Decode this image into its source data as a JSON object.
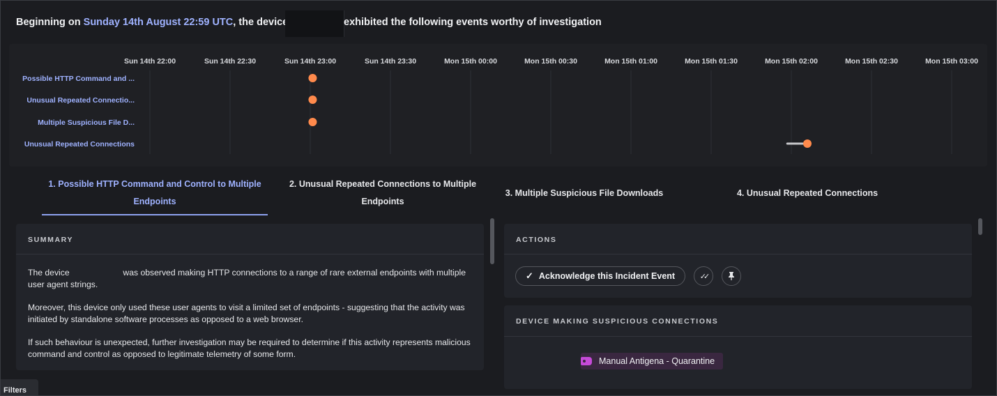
{
  "header": {
    "prefix": "Beginning on ",
    "date": "Sunday 14th August 22:59 UTC",
    "middle": ", the device",
    "suffix": "exhibited the following events worthy of investigation"
  },
  "timeline": {
    "ticks": [
      "Sun 14th 22:00",
      "Sun 14th 22:30",
      "Sun 14th 23:00",
      "Sun 14th 23:30",
      "Mon 15th 00:00",
      "Mon 15th 00:30",
      "Mon 15th 01:00",
      "Mon 15th 01:30",
      "Mon 15th 02:00",
      "Mon 15th 02:30",
      "Mon 15th 03:00"
    ],
    "rows": [
      {
        "label": "Possible HTTP Command and ...",
        "start": 2.03,
        "end": 2.03
      },
      {
        "label": "Unusual Repeated Connectio...",
        "start": 2.03,
        "end": 2.03
      },
      {
        "label": "Multiple Suspicious File D...",
        "start": 2.03,
        "end": 2.03
      },
      {
        "label": "Unusual Repeated Connections",
        "start": 7.95,
        "end": 8.2
      }
    ],
    "marker_color": "#ff8a4c"
  },
  "tabs": [
    {
      "line1": "1. Possible HTTP Command and Control to Multiple",
      "line2": "Endpoints",
      "active": true
    },
    {
      "line1": "2. Unusual Repeated Connections to Multiple",
      "line2": "Endpoints",
      "active": false
    },
    {
      "line1": "3. Multiple Suspicious File Downloads",
      "line2": "",
      "active": false
    },
    {
      "line1": "4. Unusual Repeated Connections",
      "line2": "",
      "active": false
    }
  ],
  "summary": {
    "title": "SUMMARY",
    "p1_start": "The device",
    "p1_end": "was observed making HTTP connections to a range of rare external endpoints with multiple user agent strings.",
    "p2": "Moreover, this device only used these user agents to visit a limited set of endpoints - suggesting that the activity was initiated by standalone software processes as opposed to a web browser.",
    "p3": "If such behaviour is unexpected, further investigation may be required to determine if this activity represents malicious command and control as opposed to legitimate telemetry of some form."
  },
  "actions": {
    "title": "ACTIONS",
    "acknowledge_label": "Acknowledge this Incident Event"
  },
  "device_panel": {
    "title": "DEVICE MAKING SUSPICIOUS CONNECTIONS",
    "tag_label": "Manual Antigena - Quarantine"
  },
  "filters_label": "Filters",
  "colors": {
    "accent": "#9fb2ff",
    "marker": "#ff8a4c",
    "tag": "#c64ad8"
  }
}
